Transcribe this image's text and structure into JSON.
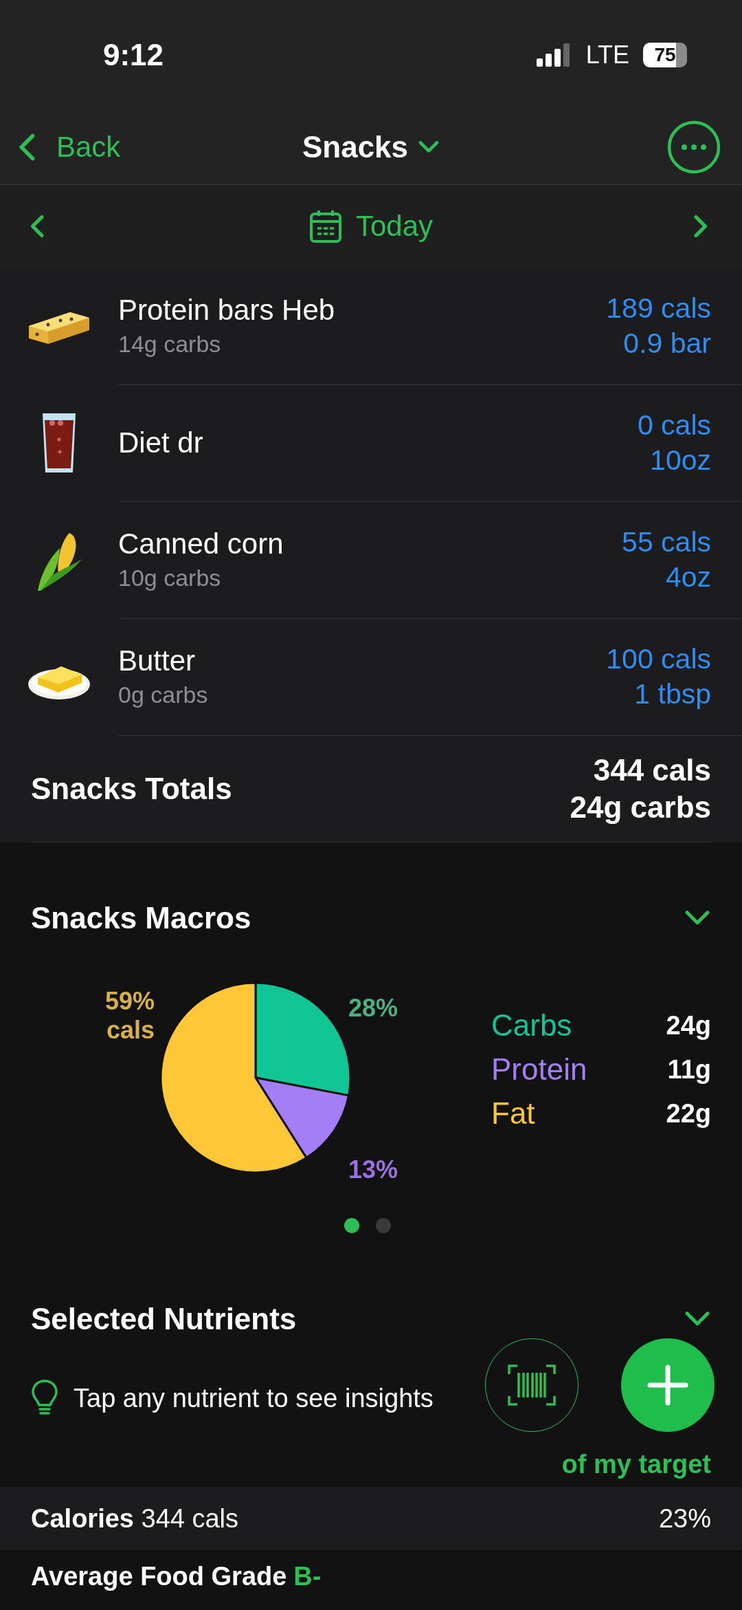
{
  "status_bar": {
    "time": "9:12",
    "network": "LTE",
    "battery": "75"
  },
  "nav": {
    "back": "Back",
    "title": "Snacks"
  },
  "date_bar": {
    "label": "Today"
  },
  "foods": [
    {
      "kind": "bar",
      "name": "Protein bars Heb",
      "detail": "14g carbs",
      "calories": "189 cals",
      "amount": "0.9 bar"
    },
    {
      "kind": "soda",
      "name": "Diet dr",
      "calories": "0 cals",
      "amount": "10oz"
    },
    {
      "kind": "corn",
      "name": "Canned corn",
      "detail": "10g carbs",
      "calories": "55 cals",
      "amount": "4oz"
    },
    {
      "kind": "butter",
      "name": "Butter",
      "detail": "0g carbs",
      "calories": "100 cals",
      "amount": "1 tbsp"
    }
  ],
  "totals": {
    "label": "Snacks Totals",
    "calories": "344 cals",
    "carbs": "24g carbs"
  },
  "macros": {
    "title": "Snacks Macros",
    "expanded": true,
    "chart_data": {
      "type": "pie",
      "categories": [
        "Carbs",
        "Protein",
        "Fat"
      ],
      "values": [
        28,
        13,
        59
      ],
      "value_labels": [
        "28%",
        "13%",
        "59% cals"
      ]
    },
    "legend": [
      {
        "amount": "24g",
        "color": "#10c694"
      },
      {
        "amount": "11g",
        "color": "#a47ef5"
      },
      {
        "amount": "22g",
        "color": "#fec737"
      }
    ],
    "pages": [
      {
        "selected": true
      },
      {
        "selected": false
      }
    ]
  },
  "nutrients": {
    "title": "Selected Nutrients",
    "expanded": true,
    "tip": "Tap any nutrient to see insights",
    "target_note": "of my target",
    "calories": {
      "label": "Calories",
      "value": "344 cals",
      "percent": "23%"
    },
    "grade": {
      "label": "Average Food Grade",
      "value": "B-"
    }
  }
}
